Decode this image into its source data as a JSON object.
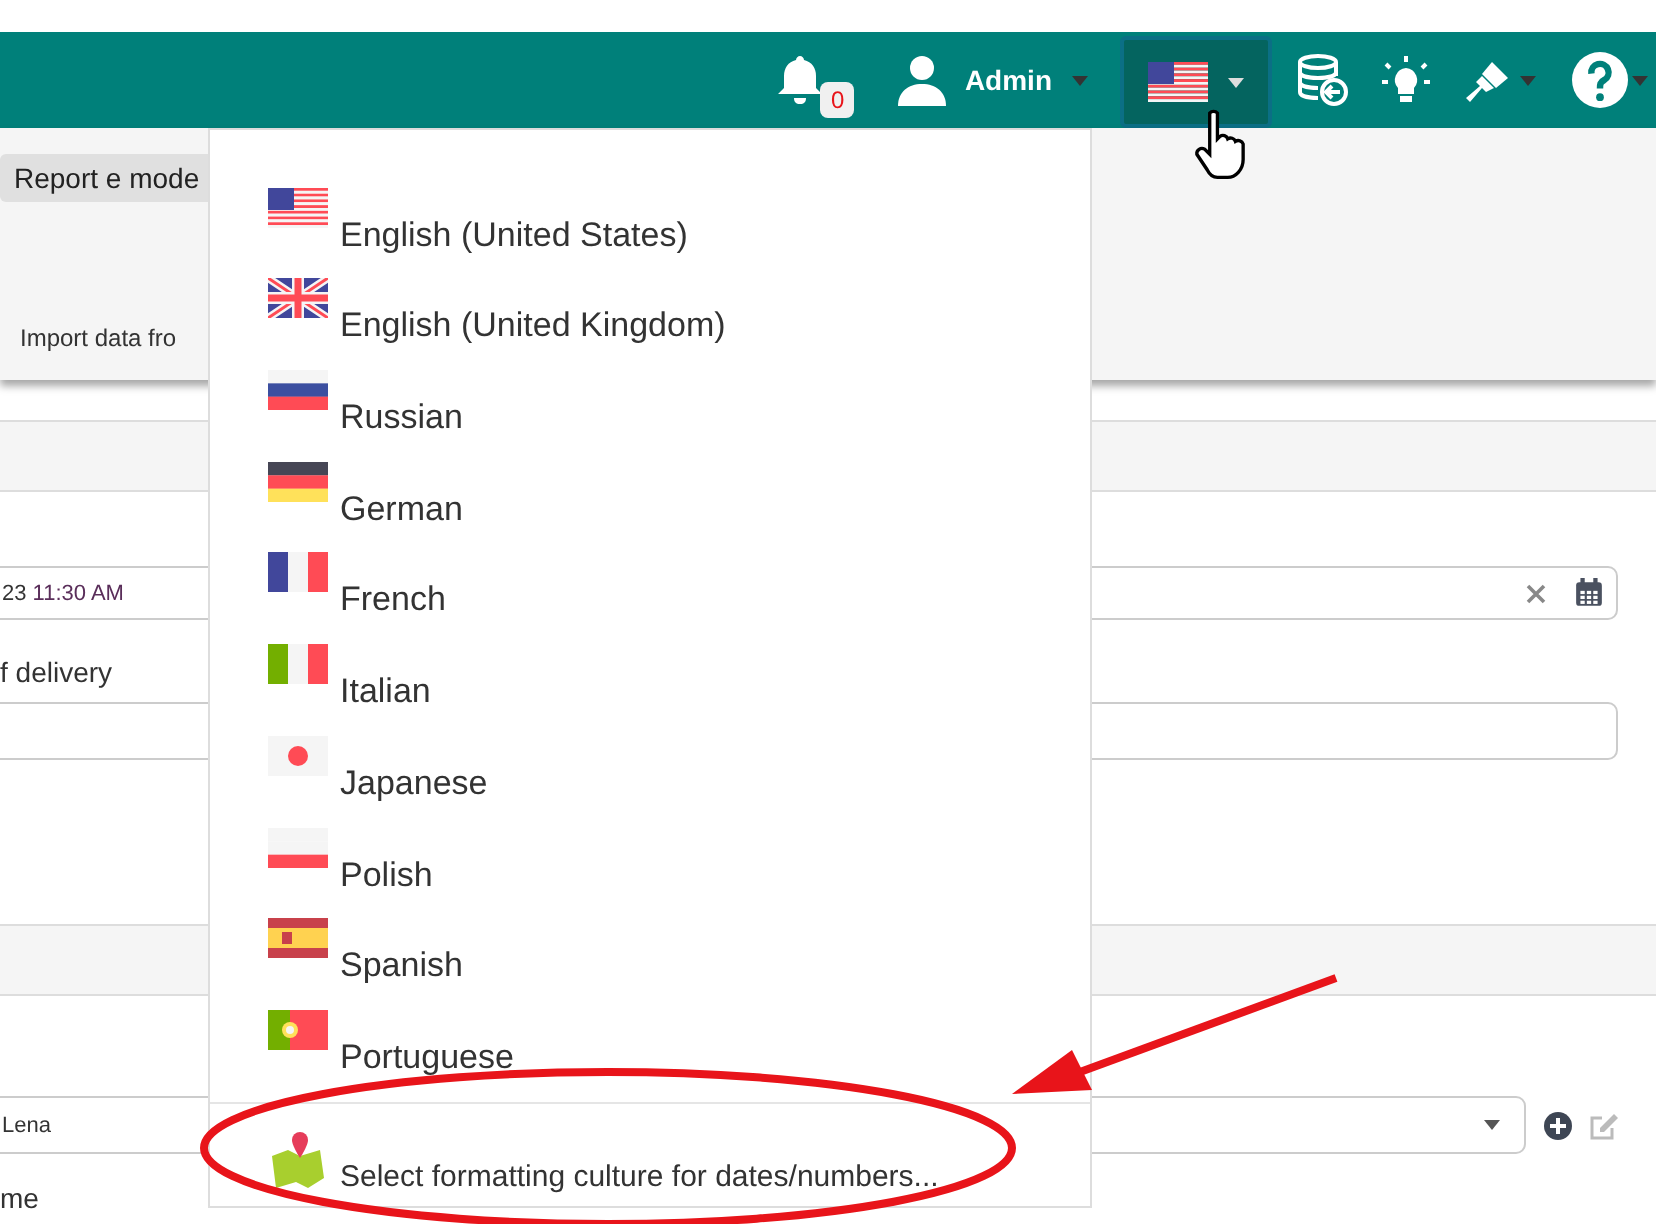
{
  "topbar": {
    "notifications": "0",
    "user": "Admin"
  },
  "toolbar": {
    "tab": "Report e mode",
    "action": "Import data fro"
  },
  "form": {
    "date_value": "23",
    "time_value": "11:30 AM",
    "delivery_label": "f delivery",
    "person_value": "Lena",
    "bottom_label": "me"
  },
  "language_menu": {
    "items": [
      {
        "kind": "us",
        "label": "English (United States)"
      },
      {
        "kind": "gb",
        "label": "English (United Kingdom)"
      },
      {
        "kind": "ru",
        "label": "Russian"
      },
      {
        "kind": "de",
        "label": "German"
      },
      {
        "kind": "fr",
        "label": "French"
      },
      {
        "kind": "it",
        "label": "Italian"
      },
      {
        "kind": "jp",
        "label": "Japanese"
      },
      {
        "kind": "pl",
        "label": "Polish"
      },
      {
        "kind": "es",
        "label": "Spanish"
      },
      {
        "kind": "pt",
        "label": "Portuguese"
      }
    ],
    "culture_item": "Select formatting culture for dates/numbers..."
  }
}
